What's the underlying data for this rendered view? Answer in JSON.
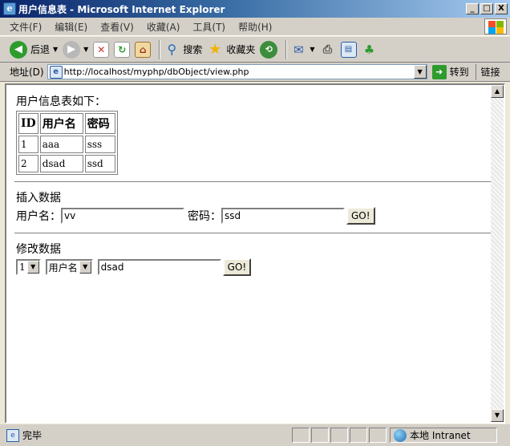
{
  "window": {
    "title": "用户信息表 - Microsoft Internet Explorer",
    "controls": {
      "minimize": "_",
      "maximize": "□",
      "close": "X"
    }
  },
  "menu": {
    "items": [
      "文件(F)",
      "编辑(E)",
      "查看(V)",
      "收藏(A)",
      "工具(T)",
      "帮助(H)"
    ]
  },
  "toolbar": {
    "back_label": "后退",
    "search_label": "搜索",
    "favorites_label": "收藏夹"
  },
  "address": {
    "label": "地址(D)",
    "url": "http://localhost/myphp/dbObject/view.php",
    "go_label": "转到",
    "links_label": "链接"
  },
  "page": {
    "table_title": "用户信息表如下：",
    "table": {
      "headers": [
        "ID",
        "用户名",
        "密码"
      ],
      "rows": [
        [
          "1",
          "aaa",
          "sss"
        ],
        [
          "2",
          "dsad",
          "ssd"
        ]
      ]
    },
    "insert": {
      "title": "插入数据",
      "username_label": "用户名：",
      "username_value": "vv",
      "password_label": "密码：",
      "password_value": "ssd",
      "submit_label": "GO!"
    },
    "modify": {
      "title": "修改数据",
      "id_select_value": "1",
      "field_select_value": "用户名",
      "value": "dsad",
      "submit_label": "GO!"
    }
  },
  "status": {
    "text": "完毕",
    "zone_label": "本地 Intranet"
  },
  "colors": {
    "titlebar_start": "#0A246A",
    "chrome": "#D4D0C8"
  }
}
